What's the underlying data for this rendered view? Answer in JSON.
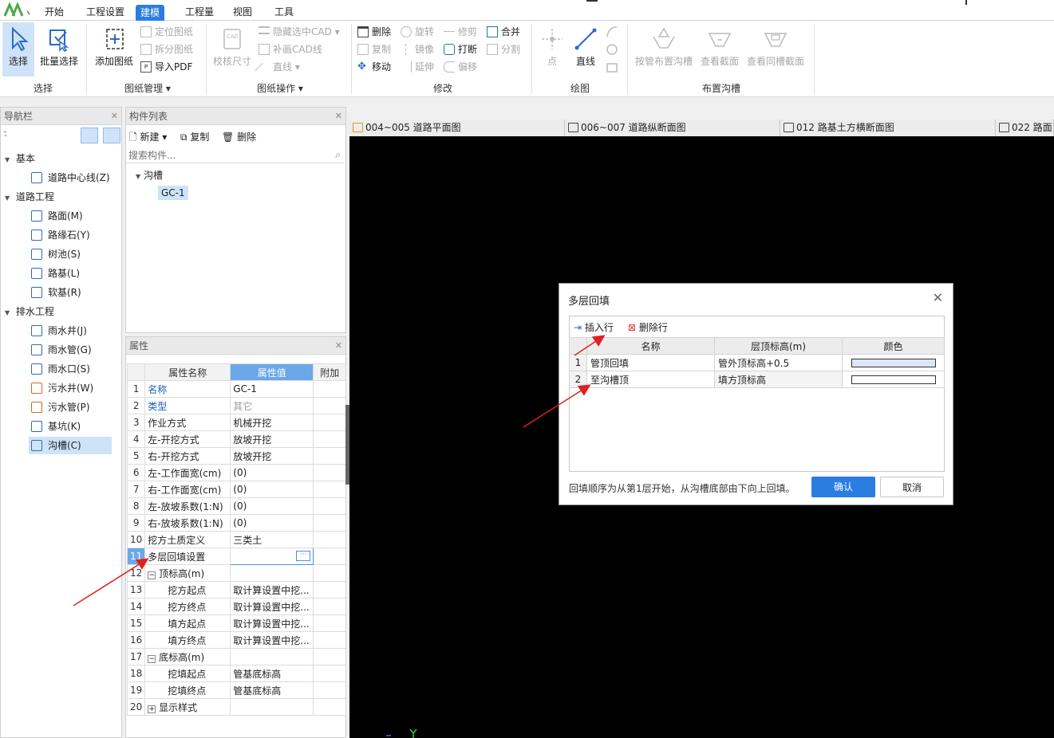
{
  "menu": [
    "开始",
    "工程设置",
    "建模",
    "工程量",
    "视图",
    "工具"
  ],
  "ribbon": {
    "select": "选择",
    "batch_select": "批量选择",
    "add_drawing": "添加图纸",
    "locate_drawing": "定位图纸",
    "split_drawing": "拆分图纸",
    "import_pdf": "导入PDF",
    "check_size": "校核尺寸",
    "hide_cad": "隐藏选中CAD",
    "patch_cad": "补画CAD线",
    "line_small": "直线",
    "delete": "删除",
    "rotate": "旋转",
    "trim": "修剪",
    "merge": "合并",
    "copy": "复制",
    "mirror": "镜像",
    "break": "打断",
    "split": "分割",
    "move": "移动",
    "extend": "延伸",
    "offset": "偏移",
    "point": "点",
    "line": "直线",
    "layout_by_pipe": "按管布置沟槽",
    "view_section": "查看截面",
    "view_same_section": "查看同槽截面",
    "groups": {
      "select": "选择",
      "drawing_mgmt": "图纸管理",
      "drawing_ops": "图纸操作",
      "modify": "修改",
      "draw": "绘图",
      "trench_layout": "布置沟槽"
    }
  },
  "nav": {
    "title": "导航栏",
    "categories": [
      {
        "label": "基本",
        "items": [
          "道路中心线(Z)"
        ]
      },
      {
        "label": "道路工程",
        "items": [
          "路面(M)",
          "路缘石(Y)",
          "树池(S)",
          "路基(L)",
          "软基(R)"
        ]
      },
      {
        "label": "排水工程",
        "items": [
          "雨水井(J)",
          "雨水管(G)",
          "雨水口(S)",
          "污水井(W)",
          "污水管(P)",
          "基坑(K)",
          "沟槽(C)"
        ]
      }
    ]
  },
  "components": {
    "title": "构件列表",
    "new": "新建",
    "copy": "复制",
    "delete": "删除",
    "search_placeholder": "搜索构件...",
    "group": "沟槽",
    "item": "GC-1"
  },
  "properties": {
    "title": "属性",
    "headers": [
      "属性名称",
      "属性值",
      "附加"
    ],
    "rows": [
      {
        "n": "1",
        "name": "名称",
        "value": "GC-1"
      },
      {
        "n": "2",
        "name": "类型",
        "value": "其它"
      },
      {
        "n": "3",
        "name": "作业方式",
        "value": "机械开挖"
      },
      {
        "n": "4",
        "name": "左-开挖方式",
        "value": "放坡开挖"
      },
      {
        "n": "5",
        "name": "右-开挖方式",
        "value": "放坡开挖"
      },
      {
        "n": "6",
        "name": "左-工作面宽(cm)",
        "value": "(0)"
      },
      {
        "n": "7",
        "name": "右-工作面宽(cm)",
        "value": "(0)"
      },
      {
        "n": "8",
        "name": "左-放坡系数(1:N)",
        "value": "(0)"
      },
      {
        "n": "9",
        "name": "右-放坡系数(1:N)",
        "value": "(0)"
      },
      {
        "n": "10",
        "name": "挖方土质定义",
        "value": "三类土"
      },
      {
        "n": "11",
        "name": "多层回填设置",
        "value": ""
      },
      {
        "n": "12",
        "name": "顶标高(m)",
        "value": ""
      },
      {
        "n": "13",
        "name": "挖方起点",
        "value": "取计算设置中挖..."
      },
      {
        "n": "14",
        "name": "挖方终点",
        "value": "取计算设置中挖..."
      },
      {
        "n": "15",
        "name": "填方起点",
        "value": "取计算设置中挖..."
      },
      {
        "n": "16",
        "name": "填方终点",
        "value": "取计算设置中挖..."
      },
      {
        "n": "17",
        "name": "底标高(m)",
        "value": ""
      },
      {
        "n": "18",
        "name": "挖填起点",
        "value": "管基底标高"
      },
      {
        "n": "19",
        "name": "挖填终点",
        "value": "管基底标高"
      },
      {
        "n": "20",
        "name": "显示样式",
        "value": ""
      }
    ]
  },
  "cad_tabs": [
    "004~005 道路平面图",
    "006~007 道路纵断面图",
    "012 路基土方横断面图",
    "022 路面"
  ],
  "dialog": {
    "title": "多层回填",
    "insert_row": "插入行",
    "delete_row": "删除行",
    "headers": [
      "名称",
      "层顶标高(m)",
      "颜色"
    ],
    "rows": [
      {
        "n": "1",
        "name": "管顶回填",
        "elev": "管外顶标高+0.5",
        "color": "#dde6f6"
      },
      {
        "n": "2",
        "name": "至沟槽顶",
        "elev": "填方顶标高",
        "color": "#ffffff"
      }
    ],
    "note": "回填顺序为从第1层开始，从沟槽底部由下向上回填。",
    "ok": "确认",
    "cancel": "取消"
  }
}
